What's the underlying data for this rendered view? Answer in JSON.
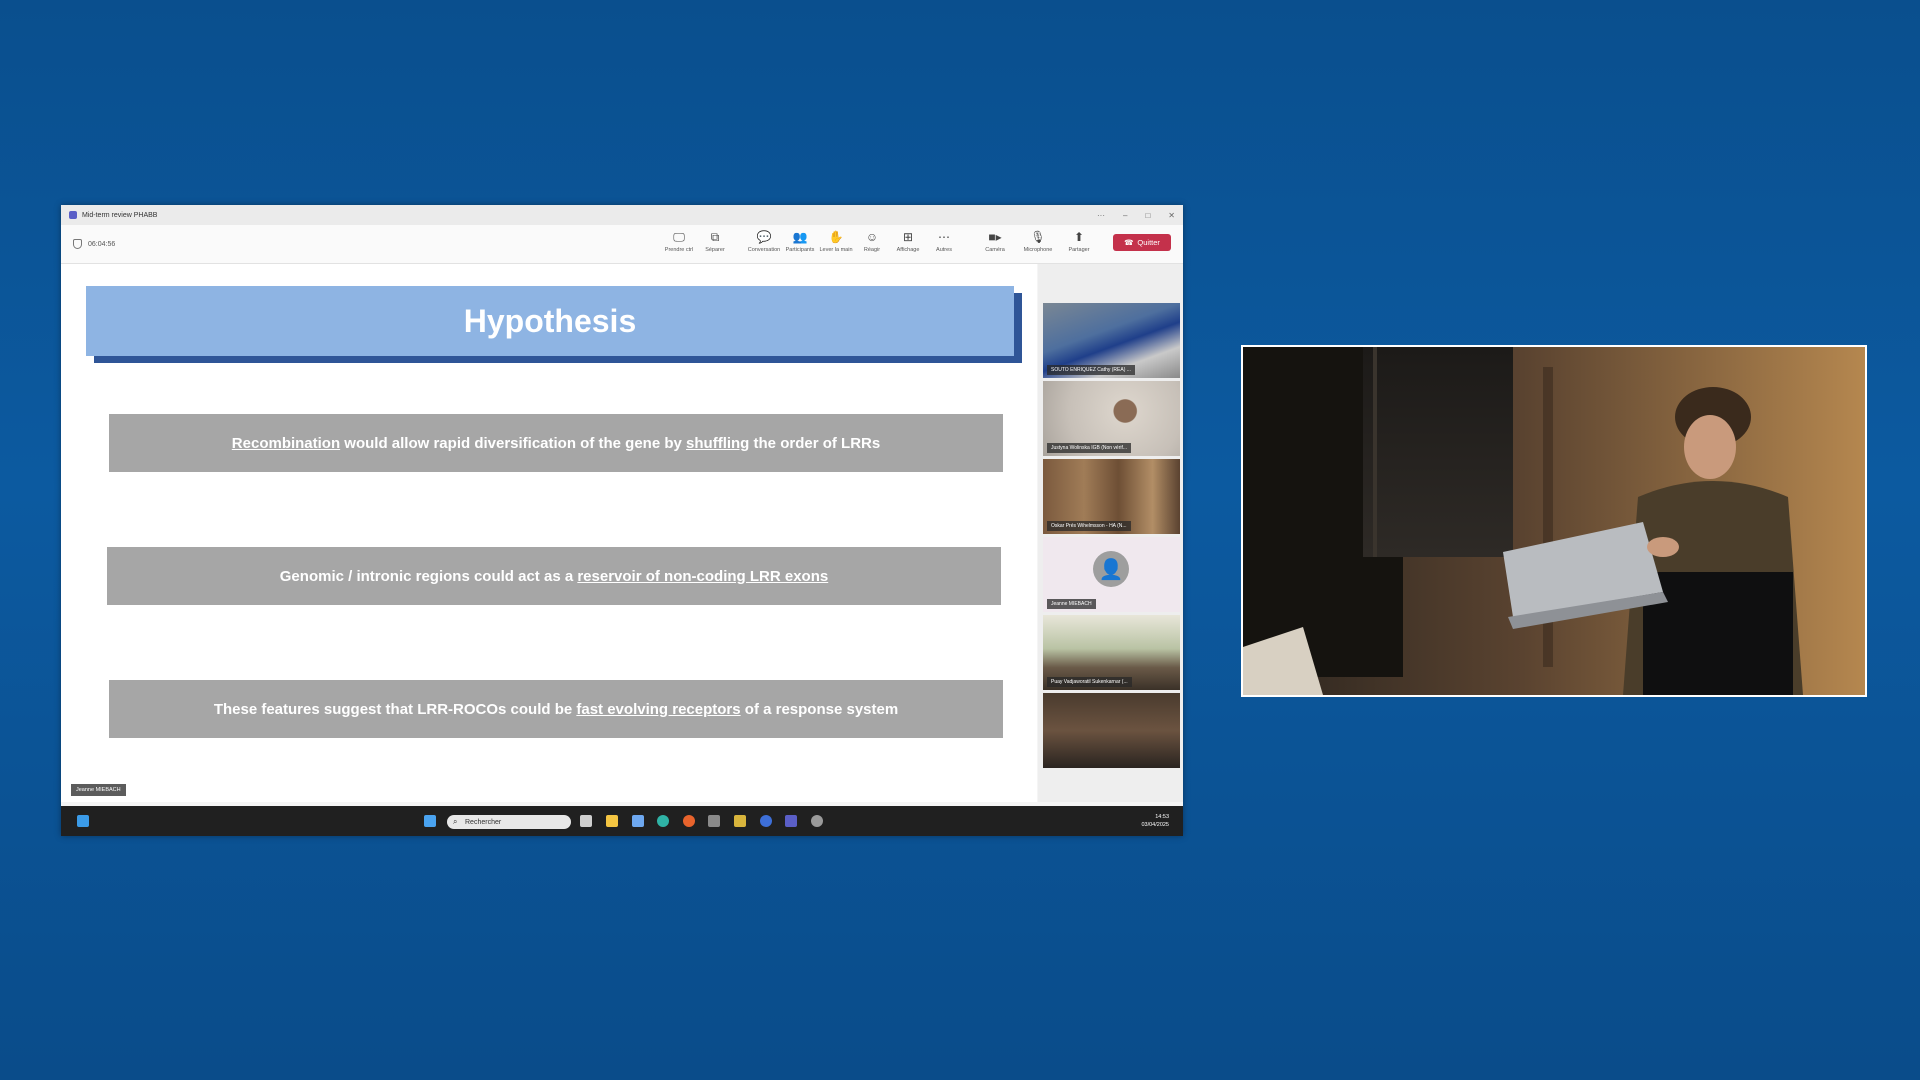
{
  "window": {
    "title": "Mid-term review PHABB",
    "timer": "06:04:56"
  },
  "toolbar": {
    "buttons": [
      {
        "label": "Prendre ctrl",
        "icon": "screen-control-icon"
      },
      {
        "label": "Séparer",
        "icon": "pop-out-icon"
      },
      {
        "label": "Conversation",
        "icon": "chat-icon"
      },
      {
        "label": "Participants",
        "icon": "people-icon"
      },
      {
        "label": "Lever la main",
        "icon": "raise-hand-icon"
      },
      {
        "label": "Réagir",
        "icon": "react-icon"
      },
      {
        "label": "Affichage",
        "icon": "view-icon"
      },
      {
        "label": "Autres",
        "icon": "more-icon"
      },
      {
        "label": "Caméra",
        "icon": "camera-icon"
      },
      {
        "label": "Microphone",
        "icon": "microphone-icon"
      },
      {
        "label": "Partager",
        "icon": "share-icon"
      }
    ],
    "quit_label": "Quitter",
    "quit_color": "#c4314b"
  },
  "slide": {
    "title": "Hypothesis",
    "title_bg": "#8eb4e3",
    "box_bg": "#a6a6a6"
  },
  "gallery": {
    "participants": [
      {
        "name": "SOUTO ENRIQUEZ Cathy (REA) ..."
      },
      {
        "name": "Justyna Wolinska IGB (Non vérif..."
      },
      {
        "name": "Oskar Prés Wihelmsson - HA (N..."
      },
      {
        "name": "Jeanne MIEBACH"
      },
      {
        "name": "Puay Vadjaworatil Sukenkarnar (..."
      },
      {
        "name": ""
      }
    ]
  },
  "speaker_label": "Jeanne MIEBACH",
  "taskbar": {
    "search_placeholder": "Rechercher",
    "time": "14:53",
    "date": "03/04/2025"
  }
}
